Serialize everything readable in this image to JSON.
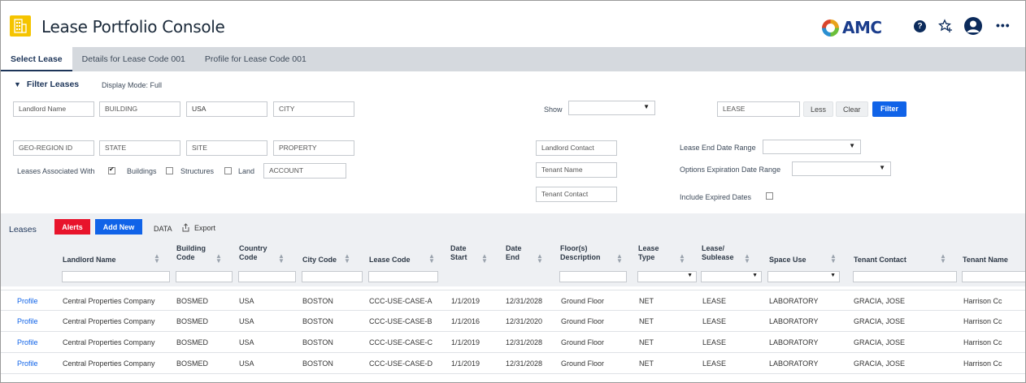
{
  "header": {
    "title": "Lease Portfolio Console",
    "brand": "AMC",
    "icons": [
      "building-icon",
      "help-icon",
      "favorites-star-icon",
      "user-avatar-icon",
      "more-icon"
    ]
  },
  "tabs": [
    {
      "label": "Select Lease",
      "active": true
    },
    {
      "label": "Details for Lease Code 001",
      "active": false
    },
    {
      "label": "Profile for Lease Code 001",
      "active": false
    }
  ],
  "filter": {
    "heading": "Filter Leases",
    "display_mode": "Display Mode: Full",
    "landlord_name": "Landlord Name",
    "building": "BUILDING",
    "country": "USA",
    "city": "CITY",
    "show_label": "Show",
    "lease": "LEASE",
    "less_label": "Less",
    "clear_label": "Clear",
    "filter_label": "Filter",
    "geo_region": "GEO-REGION ID",
    "state": "STATE",
    "site": "SITE",
    "property": "PROPERTY",
    "landlord_contact": "Landlord Contact",
    "lease_end_label": "Lease End Date Range",
    "associated_label": "Leases Associated With",
    "buildings_label": "Buildings",
    "buildings_checked": true,
    "structures_label": "Structures",
    "land_label": "Land",
    "account": "ACCOUNT",
    "tenant_name": "Tenant Name",
    "options_exp_label": "Options Expiration Date Range",
    "tenant_contact": "Tenant Contact",
    "include_expired_label": "Include Expired Dates"
  },
  "toolbar": {
    "section_label": "Leases",
    "alerts_label": "Alerts",
    "add_new_label": "Add New",
    "data_label": "DATA",
    "export_label": "Export",
    "colors": {
      "alerts": "#e8142b",
      "add_new": "#1063e8"
    }
  },
  "table": {
    "columns": [
      {
        "label": "Landlord Name",
        "sub": ""
      },
      {
        "label": "Building",
        "sub": "Code"
      },
      {
        "label": "Country",
        "sub": "Code"
      },
      {
        "label": "City Code",
        "sub": ""
      },
      {
        "label": "Lease Code",
        "sub": ""
      },
      {
        "label": "Date",
        "sub": "Start"
      },
      {
        "label": "Date",
        "sub": "End"
      },
      {
        "label": "Floor(s)",
        "sub": "Description"
      },
      {
        "label": "Lease",
        "sub": "Type"
      },
      {
        "label": "Lease/",
        "sub": "Sublease"
      },
      {
        "label": "Space Use",
        "sub": ""
      },
      {
        "label": "Tenant Contact",
        "sub": ""
      },
      {
        "label": "Tenant Name",
        "sub": ""
      }
    ],
    "rows": [
      [
        "Profile",
        "Central Properties Company",
        "BOSMED",
        "USA",
        "BOSTON",
        "CCC-USE-CASE-A",
        "1/1/2019",
        "12/31/2028",
        "Ground Floor",
        "NET",
        "LEASE",
        "LABORATORY",
        "GRACIA, JOSE",
        "Harrison Cc"
      ],
      [
        "Profile",
        "Central Properties Company",
        "BOSMED",
        "USA",
        "BOSTON",
        "CCC-USE-CASE-B",
        "1/1/2016",
        "12/31/2020",
        "Ground Floor",
        "NET",
        "LEASE",
        "LABORATORY",
        "GRACIA, JOSE",
        "Harrison Cc"
      ],
      [
        "Profile",
        "Central Properties Company",
        "BOSMED",
        "USA",
        "BOSTON",
        "CCC-USE-CASE-C",
        "1/1/2019",
        "12/31/2028",
        "Ground Floor",
        "NET",
        "LEASE",
        "LABORATORY",
        "GRACIA, JOSE",
        "Harrison Cc"
      ],
      [
        "Profile",
        "Central Properties Company",
        "BOSMED",
        "USA",
        "BOSTON",
        "CCC-USE-CASE-D",
        "1/1/2019",
        "12/31/2028",
        "Ground Floor",
        "NET",
        "LEASE",
        "LABORATORY",
        "GRACIA, JOSE",
        "Harrison Cc"
      ]
    ]
  }
}
